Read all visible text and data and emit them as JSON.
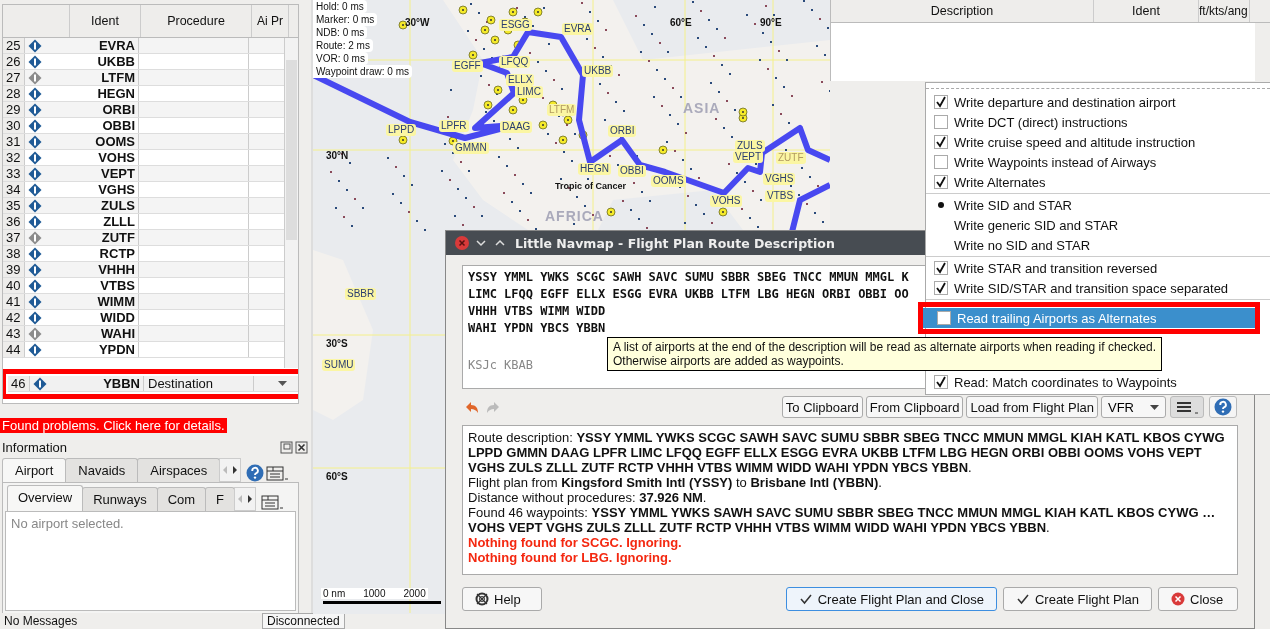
{
  "flight_plan_table": {
    "columns": [
      "Ident",
      "Procedure",
      "Ai Pr"
    ],
    "rows": [
      {
        "number": "25",
        "ident": "EVRA",
        "procedure": "",
        "color": "#1f5a96",
        "highlighted": false
      },
      {
        "number": "26",
        "ident": "UKBB",
        "procedure": "",
        "color": "#1f5a96",
        "highlighted": false
      },
      {
        "number": "27",
        "ident": "LTFM",
        "procedure": "",
        "color": "#8c8c8c",
        "highlighted": false
      },
      {
        "number": "28",
        "ident": "HEGN",
        "procedure": "",
        "color": "#1f5a96",
        "highlighted": false
      },
      {
        "number": "29",
        "ident": "ORBI",
        "procedure": "",
        "color": "#1f5a96",
        "highlighted": false
      },
      {
        "number": "30",
        "ident": "OBBI",
        "procedure": "",
        "color": "#1f5a96",
        "highlighted": false
      },
      {
        "number": "31",
        "ident": "OOMS",
        "procedure": "",
        "color": "#1f5a96",
        "highlighted": false
      },
      {
        "number": "32",
        "ident": "VOHS",
        "procedure": "",
        "color": "#1f5a96",
        "highlighted": false
      },
      {
        "number": "33",
        "ident": "VEPT",
        "procedure": "",
        "color": "#1f5a96",
        "highlighted": false
      },
      {
        "number": "34",
        "ident": "VGHS",
        "procedure": "",
        "color": "#1f5a96",
        "highlighted": false
      },
      {
        "number": "35",
        "ident": "ZULS",
        "procedure": "",
        "color": "#1f5a96",
        "highlighted": false
      },
      {
        "number": "36",
        "ident": "ZLLL",
        "procedure": "",
        "color": "#1f5a96",
        "highlighted": false
      },
      {
        "number": "37",
        "ident": "ZUTF",
        "procedure": "",
        "color": "#8c8c8c",
        "highlighted": false
      },
      {
        "number": "38",
        "ident": "RCTP",
        "procedure": "",
        "color": "#1f5a96",
        "highlighted": false
      },
      {
        "number": "39",
        "ident": "VHHH",
        "procedure": "",
        "color": "#1f5a96",
        "highlighted": false
      },
      {
        "number": "40",
        "ident": "VTBS",
        "procedure": "",
        "color": "#1f5a96",
        "highlighted": false
      },
      {
        "number": "41",
        "ident": "WIMM",
        "procedure": "",
        "color": "#1f5a96",
        "highlighted": false
      },
      {
        "number": "42",
        "ident": "WIDD",
        "procedure": "",
        "color": "#1f5a96",
        "highlighted": false
      },
      {
        "number": "43",
        "ident": "WAHI",
        "procedure": "",
        "color": "#8c8c8c",
        "highlighted": false
      },
      {
        "number": "44",
        "ident": "YPDN",
        "procedure": "",
        "color": "#1f5a96",
        "highlighted": false
      },
      {
        "number": "46",
        "ident": "YBBN",
        "procedure": "Destination",
        "color": "#1f5a96",
        "highlighted": true
      }
    ]
  },
  "problems_link": "Found problems. Click here for details.",
  "information": {
    "title": "Information",
    "tabs": [
      {
        "label": "Airport",
        "selected": true
      },
      {
        "label": "Navaids",
        "selected": false
      },
      {
        "label": "Airspaces",
        "selected": false
      }
    ],
    "subtabs": [
      {
        "label": "Overview",
        "selected": true
      },
      {
        "label": "Runways",
        "selected": false
      },
      {
        "label": "Com",
        "selected": false
      },
      {
        "label": "F",
        "selected": false
      }
    ],
    "message": "No airport selected."
  },
  "map": {
    "timings": [
      "Hold: 0 ms",
      "Marker: 0 ms",
      "NDB: 0 ms",
      "Route: 2 ms",
      "VOR: 0 ms",
      "Waypoint draw: 0 ms"
    ],
    "grid_labels": [
      "30°W",
      "60°E",
      "90°E",
      "30°N",
      "30°S",
      "60°S"
    ],
    "region_labels": [
      "ASIA",
      "AFRICA",
      "Tropic of Cancer"
    ],
    "waypoints": [
      "ESGG",
      "EVRA",
      "EGFF",
      "LFQQ",
      "ELLX",
      "LIMC",
      "UKBB",
      "LTFM",
      "LPPD",
      "LPFR",
      "DAAG",
      "GMMN",
      "ORBI",
      "HEGN",
      "OBBI",
      "OOMS",
      "ZULS",
      "VEPT",
      "ZUTF",
      "VGHS",
      "VOHS",
      "VTBS",
      "SBBR",
      "SUMU"
    ],
    "scale": [
      "0 nm",
      "1000",
      "2000"
    ]
  },
  "route_table": {
    "columns": [
      "Description",
      "Ident",
      "ft/kts/ang"
    ]
  },
  "dialog": {
    "title": "Little Navmap - Flight Plan Route Description",
    "input_lines": [
      "YSSY YMML YWKS SCGC SAWH SAVC SUMU SBBR SBEG TNCC MMUN MMGL K",
      "LIMC LFQQ EGFF ELLX ESGG EVRA UKBB LTFM LBG HEGN ORBI OBBI OO",
      "VHHH VTBS WIMM WIDD",
      "WAHI YPDN YBCS YBBN"
    ],
    "alternates_line": "KSJc KBAB",
    "toolbar": {
      "buttons": [
        "To Clipboard",
        "From Clipboard",
        "Load from Flight Plan"
      ],
      "flight_rules": "VFR"
    },
    "result": [
      {
        "kind": "info",
        "text": "Route description: **YSSY YMML YWKS SCGC SAWH SAVC SUMU SBBR SBEG TNCC MMUN MMGL KIAH KATL KBOS CYWG LPPD GMMN DAAG LPFR LIMC LFQQ EGFF ELLX ESGG EVRA UKBB LTFM LBG HEGN ORBI OBBI OOMS VOHS VEPT VGHS ZULS ZLLL ZUTF RCTP VHHH VTBS WIMM WIDD WAHI YPDN YBCS YBBN**."
      },
      {
        "kind": "info",
        "text": "Flight plan from **Kingsford Smith Intl (YSSY)** to **Brisbane Intl (YBBN)**."
      },
      {
        "kind": "info",
        "text": "Distance without procedures: **37.926 NM**."
      },
      {
        "kind": "info",
        "text": "Found 46 waypoints: **YSSY YMML YWKS SAWH SAVC SUMU SBBR SBEG TNCC MMUN MMGL KIAH KATL KBOS CYWG … VOHS VEPT VGHS ZULS ZLLL ZUTF RCTP VHHH VTBS WIMM WIDD WAHI YPDN YBCS YBBN**."
      },
      {
        "kind": "error",
        "text": "Nothing found for SCGC. Ignoring."
      },
      {
        "kind": "error",
        "text": "Nothing found for LBG. Ignoring."
      }
    ],
    "buttons": [
      {
        "label": "Help",
        "kind": "help"
      },
      {
        "label": "Create Flight Plan and Close",
        "kind": "default"
      },
      {
        "label": "Create Flight Plan",
        "kind": "ok"
      },
      {
        "label": "Close",
        "kind": "close"
      }
    ]
  },
  "options_menu": [
    {
      "kind": "check",
      "label": "Write departure and destination airport",
      "checked": true,
      "highlighted": false
    },
    {
      "kind": "check",
      "label": "Write DCT (direct) instructions",
      "checked": false,
      "highlighted": false
    },
    {
      "kind": "check",
      "label": "Write cruise speed and altitude instruction",
      "checked": true,
      "highlighted": false
    },
    {
      "kind": "check",
      "label": "Write Waypoints instead of Airways",
      "checked": false,
      "highlighted": false
    },
    {
      "kind": "check",
      "label": "Write Alternates",
      "checked": true,
      "highlighted": false
    },
    {
      "kind": "separator"
    },
    {
      "kind": "radio",
      "label": "Write SID and STAR",
      "selected": true,
      "highlighted": false
    },
    {
      "kind": "radio",
      "label": "Write generic SID and STAR",
      "selected": false,
      "highlighted": false
    },
    {
      "kind": "radio",
      "label": "Write no SID and STAR",
      "selected": false,
      "highlighted": false
    },
    {
      "kind": "separator"
    },
    {
      "kind": "check",
      "label": "Write STAR and transition reversed",
      "checked": true,
      "highlighted": false
    },
    {
      "kind": "check",
      "label": "Write SID/STAR and transition space separated",
      "checked": true,
      "highlighted": false
    },
    {
      "kind": "separator"
    },
    {
      "kind": "check",
      "label": "Read trailing Airports as Alternates",
      "checked": false,
      "highlighted": true
    },
    {
      "kind": "check",
      "label": "Read: Match coordinates to Waypoints",
      "checked": true,
      "highlighted": false
    }
  ],
  "tooltip": [
    "A list of airports at the end of the description will be read as alternate airports when reading if checked.",
    "Otherwise airports are added as waypoints."
  ],
  "status_bar": [
    "No Messages",
    "Disconnected"
  ]
}
